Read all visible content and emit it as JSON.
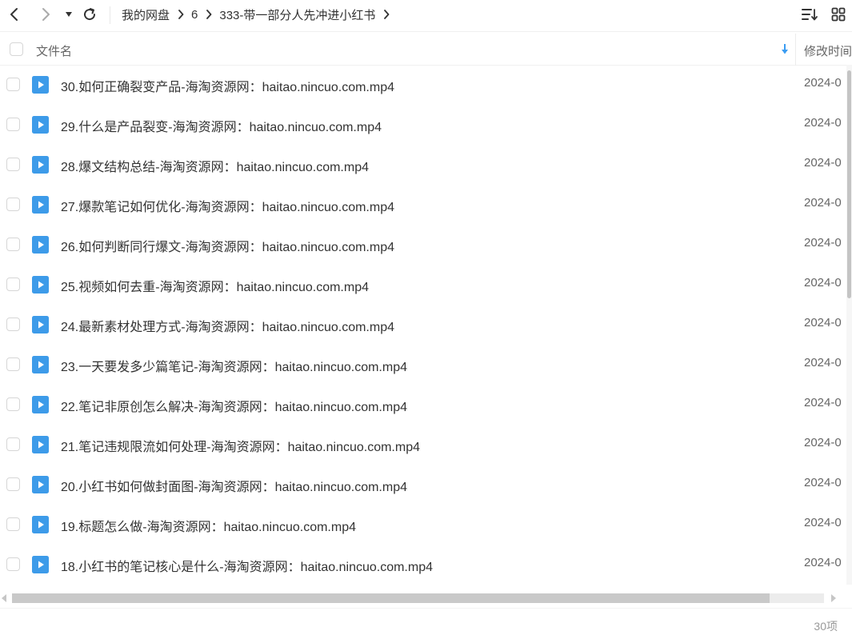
{
  "breadcrumb": [
    "我的网盘",
    "6",
    "333-带一部分人先冲进小红书"
  ],
  "header": {
    "name_label": "文件名",
    "time_label": "修改时间"
  },
  "files": [
    {
      "name": "30.如何正确裂变产品-海淘资源网：haitao.nincuo.com.mp4",
      "time": "2024-0"
    },
    {
      "name": "29.什么是产品裂变-海淘资源网：haitao.nincuo.com.mp4",
      "time": "2024-0"
    },
    {
      "name": "28.爆文结构总结-海淘资源网：haitao.nincuo.com.mp4",
      "time": "2024-0"
    },
    {
      "name": "27.爆款笔记如何优化-海淘资源网：haitao.nincuo.com.mp4",
      "time": "2024-0"
    },
    {
      "name": "26.如何判断同行爆文-海淘资源网：haitao.nincuo.com.mp4",
      "time": "2024-0"
    },
    {
      "name": "25.视频如何去重-海淘资源网：haitao.nincuo.com.mp4",
      "time": "2024-0"
    },
    {
      "name": "24.最新素材处理方式-海淘资源网：haitao.nincuo.com.mp4",
      "time": "2024-0"
    },
    {
      "name": "23.一天要发多少篇笔记-海淘资源网：haitao.nincuo.com.mp4",
      "time": "2024-0"
    },
    {
      "name": "22.笔记非原创怎么解决-海淘资源网：haitao.nincuo.com.mp4",
      "time": "2024-0"
    },
    {
      "name": "21.笔记违规限流如何处理-海淘资源网：haitao.nincuo.com.mp4",
      "time": "2024-0"
    },
    {
      "name": "20.小红书如何做封面图-海淘资源网：haitao.nincuo.com.mp4",
      "time": "2024-0"
    },
    {
      "name": "19.标题怎么做-海淘资源网：haitao.nincuo.com.mp4",
      "time": "2024-0"
    },
    {
      "name": "18.小红书的笔记核心是什么-海淘资源网：haitao.nincuo.com.mp4",
      "time": "2024-0"
    }
  ],
  "footer": {
    "count": "30项"
  },
  "icons": {
    "back": "chevron-left-icon",
    "forward": "chevron-right-icon",
    "history": "caret-down-icon",
    "refresh": "refresh-icon",
    "sort": "sort-icon",
    "view": "grid-view-icon",
    "file": "video-file-icon"
  },
  "colors": {
    "accent": "#3a9cf2",
    "file_icon": "#3d9be9"
  }
}
